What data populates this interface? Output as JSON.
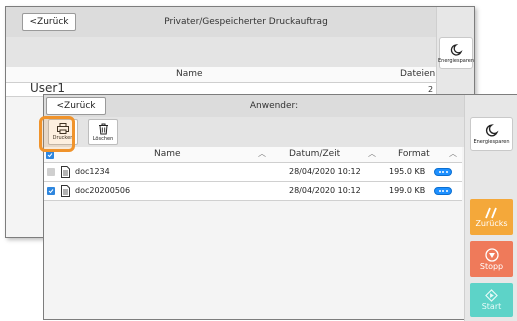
{
  "back_screen": {
    "back_label": "<Zurück",
    "title": "Privater/Gespeicherter Druckauftrag",
    "eco_label": "Energiesparen",
    "columns": {
      "name": "Name",
      "files": "Dateien"
    },
    "row": {
      "user": "User1",
      "count": "2"
    }
  },
  "front_screen": {
    "back_label": "<Zurück",
    "title": "Anwender:",
    "toolbar": {
      "print_label": "Drucken",
      "delete_label": "Löschen"
    },
    "columns": {
      "name": "Name",
      "datetime": "Datum/Zeit",
      "format": "Format"
    },
    "rows": [
      {
        "name": "doc1234",
        "datetime": "28/04/2020 10:12",
        "format": "195.0 KB",
        "checked": false
      },
      {
        "name": "doc20200506",
        "datetime": "28/04/2020 10:12",
        "format": "199.0 KB",
        "checked": true
      }
    ],
    "side": {
      "eco_label": "Energiesparen",
      "back_label": "Zurücks",
      "stop_label": "Stopp",
      "start_label": "Start"
    }
  },
  "colors": {
    "highlight": "#f0932b",
    "accent_blue": "#1e90ff",
    "back_btn": "#f4a83a",
    "stop_btn": "#ef7a5a",
    "start_btn": "#5dd3c8"
  }
}
